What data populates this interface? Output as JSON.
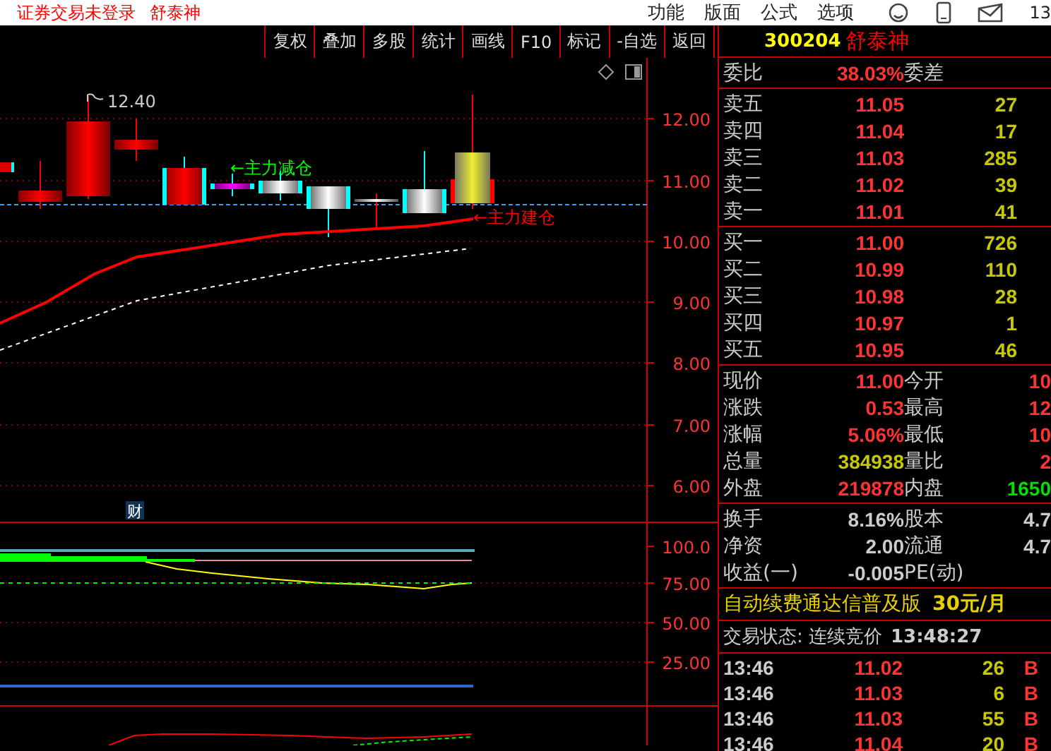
{
  "title_bar": {
    "status": "证券交易未登录",
    "stock_name": "舒泰神",
    "menu": [
      "功能",
      "版面",
      "公式",
      "选项"
    ],
    "clock": "13"
  },
  "toolbar": [
    "复权",
    "叠加",
    "多股",
    "统计",
    "画线",
    "F10",
    "标记",
    "-自选",
    "返回"
  ],
  "chart": {
    "high_label": "12.40",
    "annotations": [
      {
        "text": "←主力减仓",
        "color": "#00ff00"
      },
      {
        "text": "←主力建仓",
        "color": "#ff0000"
      }
    ],
    "price_ticks": [
      "12.00",
      "11.00",
      "10.00",
      "9.00",
      "8.00",
      "7.00",
      "6.00"
    ],
    "badge": "财",
    "indicator_ticks": [
      "100.0",
      "75.00",
      "50.00",
      "25.00"
    ]
  },
  "quote": {
    "code": "300204",
    "name": "舒泰神",
    "ratio": {
      "label": "委比",
      "value": "38.03%",
      "label2": "委差"
    },
    "asks": [
      {
        "label": "卖五",
        "price": "11.05",
        "volume": "27"
      },
      {
        "label": "卖四",
        "price": "11.04",
        "volume": "17"
      },
      {
        "label": "卖三",
        "price": "11.03",
        "volume": "285"
      },
      {
        "label": "卖二",
        "price": "11.02",
        "volume": "39"
      },
      {
        "label": "卖一",
        "price": "11.01",
        "volume": "41"
      }
    ],
    "bids": [
      {
        "label": "买一",
        "price": "11.00",
        "volume": "726"
      },
      {
        "label": "买二",
        "price": "10.99",
        "volume": "110"
      },
      {
        "label": "买三",
        "price": "10.98",
        "volume": "28"
      },
      {
        "label": "买四",
        "price": "10.97",
        "volume": "1"
      },
      {
        "label": "买五",
        "price": "10.95",
        "volume": "46"
      }
    ],
    "stats": [
      {
        "cells": [
          {
            "label": "现价",
            "value": "11.00",
            "color": "#ff3333"
          },
          {
            "label": "今开",
            "value": "10",
            "color": "#ff3333"
          }
        ]
      },
      {
        "cells": [
          {
            "label": "涨跌",
            "value": "0.53",
            "color": "#ff3333"
          },
          {
            "label": "最高",
            "value": "12",
            "color": "#ff3333"
          }
        ]
      },
      {
        "cells": [
          {
            "label": "涨幅",
            "value": "5.06%",
            "color": "#ff3333"
          },
          {
            "label": "最低",
            "value": "10",
            "color": "#ff3333"
          }
        ]
      },
      {
        "cells": [
          {
            "label": "总量",
            "value": "384938",
            "color": "#c8c800"
          },
          {
            "label": "量比",
            "value": "2",
            "color": "#ff3333"
          }
        ]
      },
      {
        "cells": [
          {
            "label": "外盘",
            "value": "219878",
            "color": "#ff3333"
          },
          {
            "label": "内盘",
            "value": "1650",
            "color": "#00e000"
          }
        ]
      }
    ],
    "info": [
      {
        "label": "换手",
        "value": "8.16%",
        "label2": "股本",
        "value2": "4.7"
      },
      {
        "label": "净资",
        "value": "2.00",
        "label2": "流通",
        "value2": "4.7"
      },
      {
        "label": "收益(一)",
        "value": "-0.005",
        "label2": "PE(动)"
      }
    ],
    "ad": {
      "text": "自动续费通达信普及版",
      "price": "30元/月"
    },
    "status": {
      "text": "交易状态: 连续竞价",
      "time": "13:48:27"
    },
    "ticks": [
      {
        "time": "13:46",
        "price": "11.02",
        "volume": "26",
        "side": "B"
      },
      {
        "time": "13:46",
        "price": "11.03",
        "volume": "6",
        "side": "B"
      },
      {
        "time": "13:46",
        "price": "11.03",
        "volume": "55",
        "side": "B"
      },
      {
        "time": "13:46",
        "price": "11.04",
        "volume": "20",
        "side": "B"
      }
    ]
  }
}
